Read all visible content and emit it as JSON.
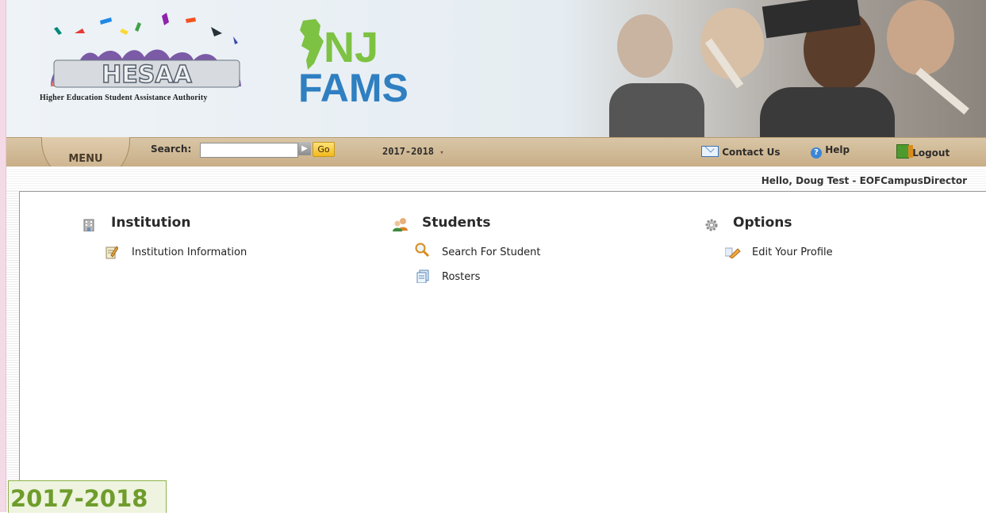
{
  "header": {
    "org_caption": "Higher Education Student Assistance Authority",
    "hesaa_letters": "HESAA",
    "fams_top": "NJ",
    "fams_bottom": "FAMS"
  },
  "toolbar": {
    "menu_label": "MENU",
    "search_label": "Search:",
    "search_value": "",
    "go_label": "Go",
    "year_selector": "2017-2018",
    "contact_label": "Contact Us",
    "help_label": "Help",
    "logout_label": "Logout"
  },
  "greeting": "Hello, Doug Test - EOFCampusDirector",
  "sections": [
    {
      "title": "Institution",
      "icon": "building-icon",
      "items": [
        {
          "label": "Institution Information",
          "icon": "edit-document-icon"
        }
      ]
    },
    {
      "title": "Students",
      "icon": "people-icon",
      "items": [
        {
          "label": "Search For Student",
          "icon": "magnifier-icon"
        },
        {
          "label": "Rosters",
          "icon": "pages-icon"
        }
      ]
    },
    {
      "title": "Options",
      "icon": "gear-icon",
      "items": [
        {
          "label": "Edit Your Profile",
          "icon": "pencil-icon"
        }
      ]
    }
  ],
  "footer_year": "2017-2018",
  "colors": {
    "toolbar": "#c9b08a",
    "badge_green": "#6f9c2c",
    "fams_green": "#7dc242",
    "fams_blue": "#2f7fc1"
  }
}
